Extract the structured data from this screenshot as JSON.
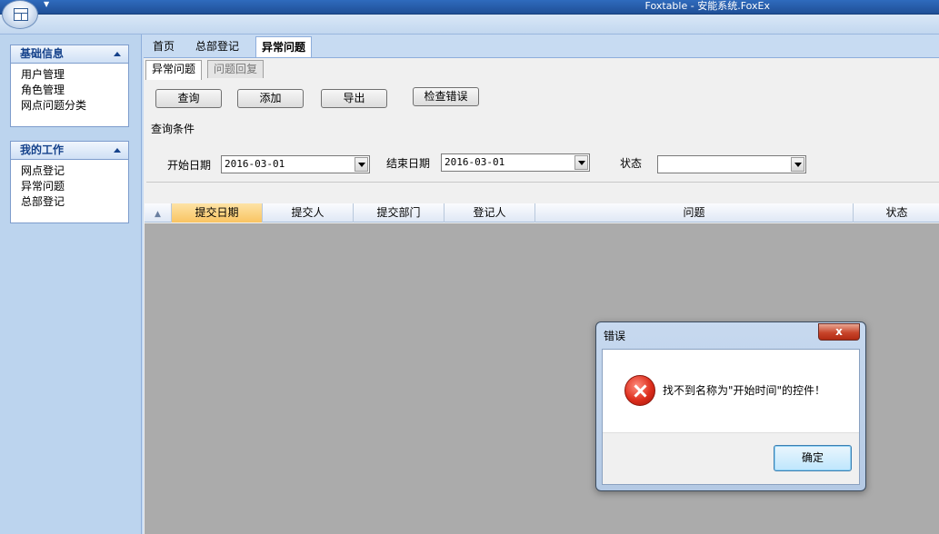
{
  "window": {
    "title": "Foxtable - 安能系统.FoxEx"
  },
  "sidebar": {
    "panels": [
      {
        "title": "基础信息",
        "items": [
          "用户管理",
          "角色管理",
          "网点问题分类"
        ]
      },
      {
        "title": "我的工作",
        "items": [
          "网点登记",
          "异常问题",
          "总部登记"
        ]
      }
    ]
  },
  "main_tabs": [
    "首页",
    "总部登记",
    "异常问题"
  ],
  "sub_tabs": [
    "异常问题",
    "问题回复"
  ],
  "toolbar": {
    "query": "查询",
    "add": "添加",
    "export": "导出",
    "check_errors": "检查错误"
  },
  "filter": {
    "group_label": "查询条件",
    "start_label": "开始日期",
    "start_value": "2016-03-01",
    "end_label": "结束日期",
    "end_value": "2016-03-01",
    "status_label": "状态",
    "status_value": ""
  },
  "grid": {
    "columns": [
      "提交日期",
      "提交人",
      "提交部门",
      "登记人",
      "问题",
      "状态"
    ]
  },
  "dialog": {
    "title": "错误",
    "close_label": "x",
    "message": "找不到名称为\"开始时间\"的控件！",
    "ok_label": "确定"
  }
}
